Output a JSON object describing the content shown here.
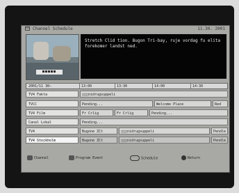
{
  "header": {
    "title": "Channel Schedule",
    "date": "11.30. 2001"
  },
  "description": "Stretch Clid tion. Bugon Tri-bay, ruje vordag fu elita forekomer landst ned.",
  "preview": {
    "logo_text": "■■■■■"
  },
  "timeline": {
    "date_label": "2001/11 30–",
    "slots": [
      "13:00",
      "13:30",
      "14:00",
      "14:30"
    ]
  },
  "channels": [
    {
      "name": "TV4 Fakta",
      "programs": [
        "□□□nidrugsuppeli"
      ]
    },
    {
      "name": "TVCC",
      "programs": [
        "Pending...",
        "Welcome Place",
        "Red"
      ]
    },
    {
      "name": "TV4 Film",
      "programs": [
        "Fr Crlig",
        "Fr Crlig",
        "Pending..."
      ]
    },
    {
      "name": "Canal Lokal",
      "programs": [
        "Pending..."
      ]
    },
    {
      "name": "TV4",
      "programs": [
        "Bugone ZCt",
        "□□□nidrugsuppeli",
        "Pendle"
      ]
    },
    {
      "name": "TV4 Stockholm",
      "programs": [
        "Bugone ZCt",
        "□□□nidrugsuppeli",
        "Pendle"
      ]
    }
  ],
  "footer": {
    "channel": "Channel",
    "program_event": "Program Event",
    "schedule": "Schedule",
    "return": "Return"
  }
}
